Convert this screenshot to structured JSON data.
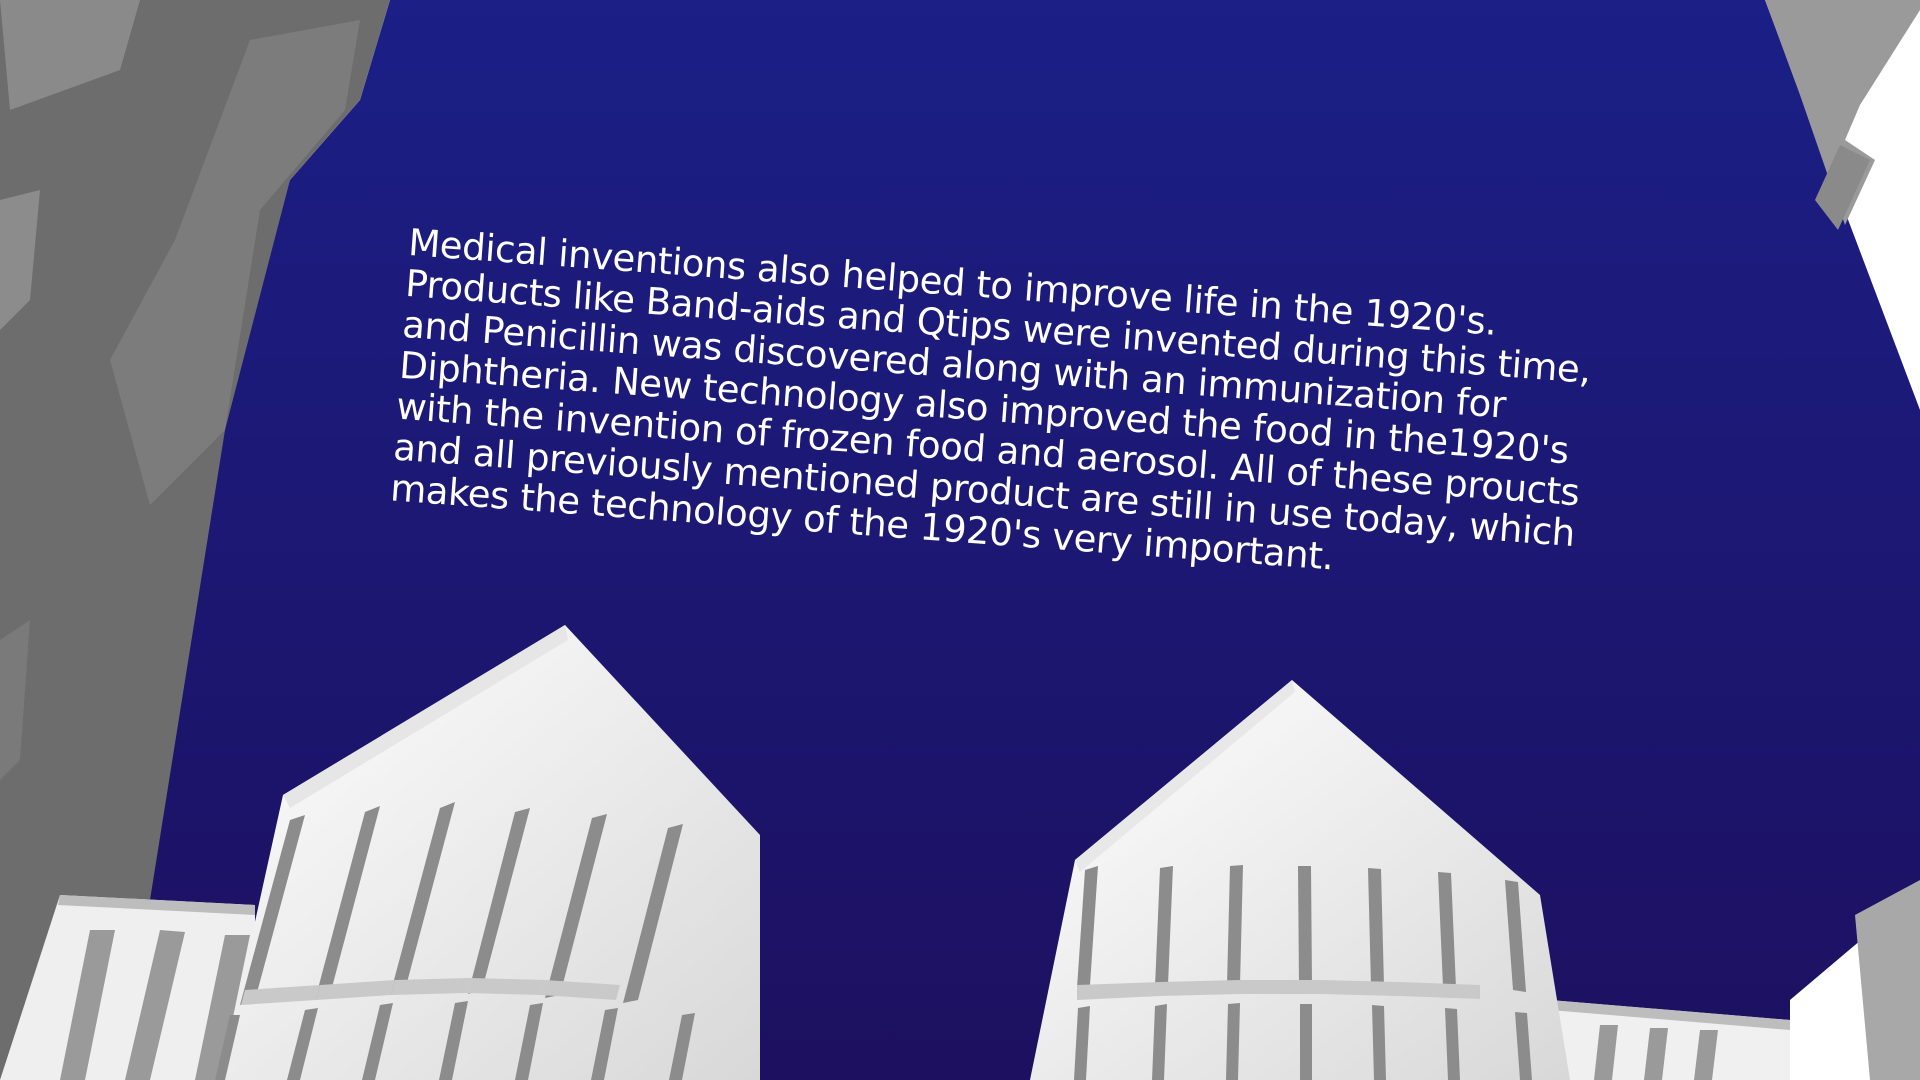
{
  "slide": {
    "body_text": "Medical inventions also helped to improve life in the 1920's.\nProducts like Band-aids and Qtips were invented during this time,\nand Penicillin was discovered along with an immunization for\nDiphtheria.  New technology also improved the food in the1920's\nwith the invention of frozen food and aerosol.  All of these proucts\nand all previously mentioned product are still in use today, which\nmakes the technology of the 1920's very important."
  },
  "colors": {
    "sky_top": "#1b1f86",
    "sky_bottom": "#1d1060",
    "text": "#ffffff",
    "building_light": "#f2f2f2",
    "building_shadow": "#b9b9b9",
    "frame_gray": "#808080",
    "frame_dark": "#6a6a6a"
  }
}
